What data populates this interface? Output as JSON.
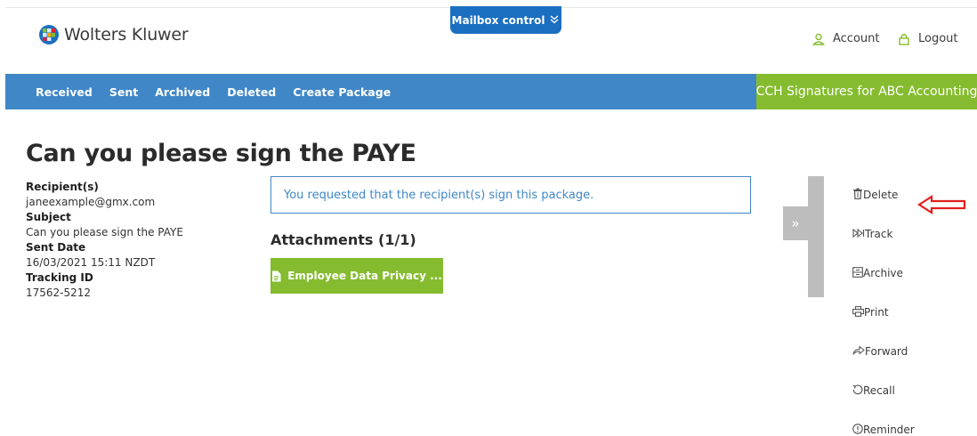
{
  "header": {
    "logo_text": "Wolters Kluwer",
    "mailbox_control_label": "Mailbox control",
    "account_label": "Account",
    "logout_label": "Logout"
  },
  "nav": {
    "items": [
      {
        "label": "Received"
      },
      {
        "label": "Sent"
      },
      {
        "label": "Archived"
      },
      {
        "label": "Deleted"
      },
      {
        "label": "Create Package"
      }
    ],
    "brand_tag": "CCH Signatures for ABC Accounting"
  },
  "package": {
    "title": "Can you please sign the PAYE",
    "recipients_label": "Recipient(s)",
    "recipients_value": "janeexample@gmx.com",
    "subject_label": "Subject",
    "subject_value": "Can you please sign the PAYE",
    "sent_date_label": "Sent Date",
    "sent_date_value": "16/03/2021 15:11 NZDT",
    "tracking_label": "Tracking ID",
    "tracking_value": "17562-5212",
    "notice": "You requested that the recipient(s) sign this package.",
    "attachments_heading": "Attachments (1/1)",
    "attachment_name": "Employee Data Privacy ..."
  },
  "actions": [
    {
      "label": "Delete",
      "icon": "trash-icon"
    },
    {
      "label": "Track",
      "icon": "track-icon"
    },
    {
      "label": "Archive",
      "icon": "archive-icon"
    },
    {
      "label": "Print",
      "icon": "print-icon"
    },
    {
      "label": "Forward",
      "icon": "forward-icon"
    },
    {
      "label": "Recall",
      "icon": "recall-icon"
    },
    {
      "label": "Reminder",
      "icon": "reminder-icon"
    }
  ],
  "toggle_glyph": "»",
  "colors": {
    "nav_blue": "#3f87c7",
    "brand_green": "#85bc2f",
    "mailbox_blue": "#1b6fc0",
    "annotation_red": "#e0201b"
  }
}
